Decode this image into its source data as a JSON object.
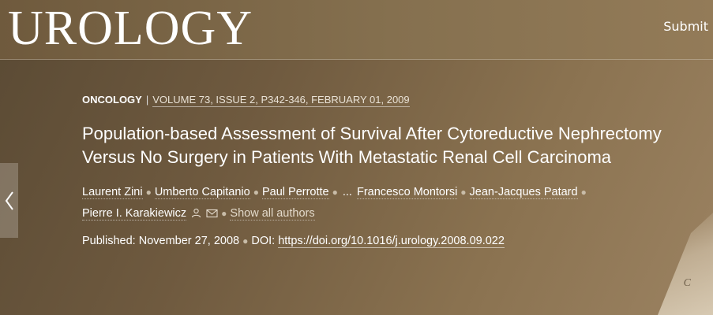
{
  "header": {
    "logo": "UROLOGY",
    "submit_label": "Submit"
  },
  "article": {
    "category": "ONCOLOGY",
    "separator": "|",
    "issue_info": "VOLUME 73, ISSUE 2, P342-346, FEBRUARY 01, 2009",
    "title": "Population-based Assessment of Survival After Cytoreductive Nephrectomy Versus No Surgery in Patients With Metastatic Renal Cell Carcinoma",
    "authors_row1": [
      "Laurent Zini",
      "Umberto Capitanio",
      "Paul Perrotte"
    ],
    "ellipsis": "...",
    "authors_row1b": [
      "Francesco Montorsi",
      "Jean-Jacques Patard"
    ],
    "corresponding_author": "Pierre I. Karakiewicz",
    "show_all_label": "Show all authors",
    "published_label": "Published: November 27, 2008",
    "doi_label": "DOI:",
    "doi_link": "https://doi.org/10.1016/j.urology.2008.09.022"
  },
  "decoration": {
    "corner_letter": "C"
  },
  "icons": [
    "chevron-left-icon",
    "person-icon",
    "envelope-icon"
  ]
}
